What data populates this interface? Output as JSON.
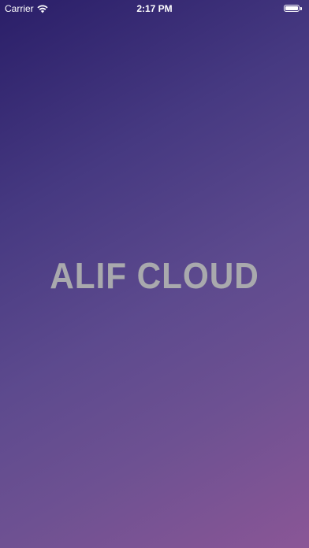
{
  "status_bar": {
    "carrier": "Carrier",
    "time": "2:17 PM",
    "wifi_icon": "wifi-icon",
    "battery_icon": "battery-icon",
    "battery_level": 1.0
  },
  "splash": {
    "title": "ALIF CLOUD",
    "title_color": "#a9a9ad",
    "gradient_start": "#2a1e68",
    "gradient_end": "#8a5696"
  }
}
